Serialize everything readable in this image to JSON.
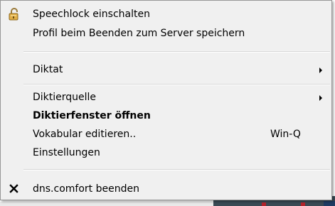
{
  "menu": {
    "items": [
      {
        "label": "Speechlock einschalten",
        "icon": "padlock-icon"
      },
      {
        "label": "Profil beim Beenden zum Server speichern"
      },
      {
        "label": "Diktat",
        "submenu": true
      },
      {
        "label": "Diktierquelle",
        "submenu": true
      },
      {
        "label": "Diktierfenster öffnen",
        "bold": true
      },
      {
        "label": "Vokabular editieren..",
        "shortcut": "Win-Q"
      },
      {
        "label": "Einstellungen"
      },
      {
        "label": "dns.comfort beenden",
        "icon": "close-x-icon"
      }
    ]
  },
  "colors": {
    "menu_bg": "#f0f0f0",
    "menu_border": "#979797",
    "separator": "#d7d7d7",
    "text": "#000000",
    "padlock": "#d9a43a"
  }
}
